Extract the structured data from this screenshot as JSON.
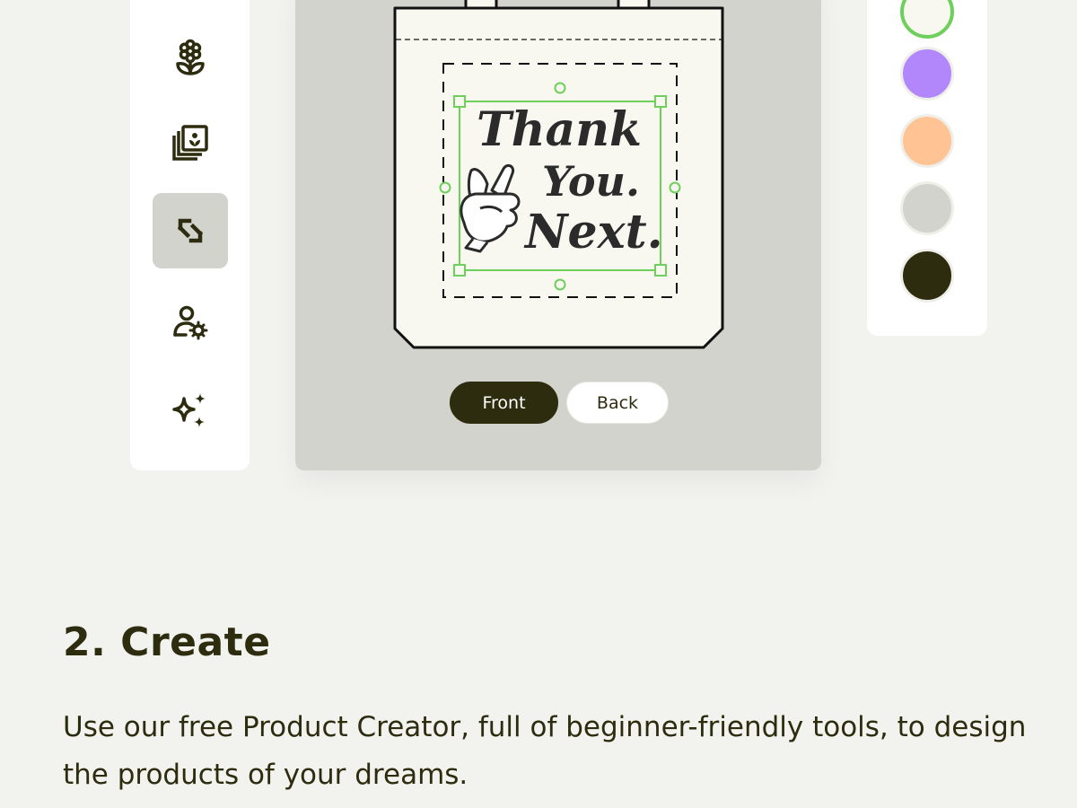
{
  "sidebar": {
    "tools": [
      {
        "icon": "flower-icon",
        "active": false
      },
      {
        "icon": "photo-stack-icon",
        "active": false
      },
      {
        "icon": "resize-icon",
        "active": true
      },
      {
        "icon": "user-settings-icon",
        "active": false
      },
      {
        "icon": "sparkles-icon",
        "active": false
      }
    ]
  },
  "canvas": {
    "design_text_lines": [
      "Thank",
      "You.",
      "Next."
    ],
    "design_graphic": "peace-hand-icon"
  },
  "view_toggle": {
    "front_label": "Front",
    "back_label": "Back",
    "selected": "Front"
  },
  "colors": {
    "swatches": [
      "#f8f8f1",
      "#b187fb",
      "#ffc394",
      "#d3d3cd",
      "#2e2c0f"
    ],
    "selected_index": 0,
    "selection_ring": "#6cd05b"
  },
  "section": {
    "title": "2. Create",
    "description": "Use our free Product Creator, full of beginner-friendly tools, to design the products of your dreams."
  }
}
